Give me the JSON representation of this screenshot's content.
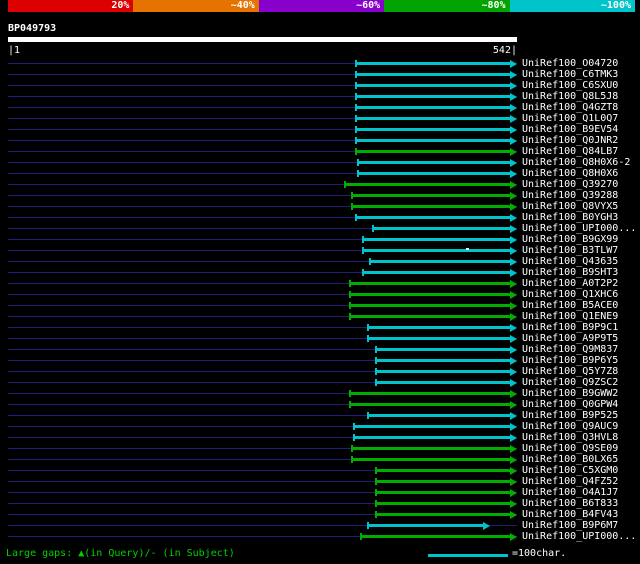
{
  "color_key": {
    "segments": [
      {
        "label": "20%",
        "color": "#dd0000"
      },
      {
        "label": "~40%",
        "color": "#e67300"
      },
      {
        "label": "~60%",
        "color": "#8800cc"
      },
      {
        "label": "~80%",
        "color": "#00a300"
      },
      {
        "label": "~100%",
        "color": "#00c4cc"
      }
    ]
  },
  "query": {
    "name": "BP049793",
    "start_tick": "|1",
    "end_tick": "542|"
  },
  "legend": {
    "gaps": "Large gaps: ▲(in Query)/- (in Subject)",
    "scale": "=100char."
  },
  "palette": {
    "~100%": "#00c4cc",
    "~80%": "#00ad00",
    "guide": "#1f1f7a",
    "query_bar": "#ffffff",
    "label": "#ffffff",
    "legend_green": "#00d000"
  },
  "chart_data": {
    "type": "bar",
    "orientation": "horizontal",
    "title": "BP049793",
    "xlabel": "",
    "xlim": [
      1,
      542
    ],
    "legend_note": "bar color encodes identity per color key; cyan ~100%, green ~80%; legend line length = 100 characters",
    "rows": [
      {
        "label": "UniRef100_O04720",
        "start": 370,
        "end": 542,
        "identity": "~100%"
      },
      {
        "label": "UniRef100_C6TMK3",
        "start": 370,
        "end": 542,
        "identity": "~100%"
      },
      {
        "label": "UniRef100_C6SXU0",
        "start": 370,
        "end": 542,
        "identity": "~100%"
      },
      {
        "label": "UniRef100_Q8L5J8",
        "start": 370,
        "end": 542,
        "identity": "~100%"
      },
      {
        "label": "UniRef100_Q4GZT8",
        "start": 370,
        "end": 542,
        "identity": "~100%"
      },
      {
        "label": "UniRef100_Q1L0Q7",
        "start": 370,
        "end": 542,
        "identity": "~100%"
      },
      {
        "label": "UniRef100_B9EV54",
        "start": 370,
        "end": 542,
        "identity": "~100%"
      },
      {
        "label": "UniRef100_Q0JNR2",
        "start": 370,
        "end": 542,
        "identity": "~100%"
      },
      {
        "label": "UniRef100_Q84LB7",
        "start": 370,
        "end": 542,
        "identity": "~80%"
      },
      {
        "label": "UniRef100_Q8H0X6-2",
        "start": 372,
        "end": 542,
        "identity": "~100%"
      },
      {
        "label": "UniRef100_Q8H0X6",
        "start": 372,
        "end": 542,
        "identity": "~100%"
      },
      {
        "label": "UniRef100_Q39270",
        "start": 358,
        "end": 542,
        "identity": "~80%"
      },
      {
        "label": "UniRef100_Q39288",
        "start": 366,
        "end": 542,
        "identity": "~80%"
      },
      {
        "label": "UniRef100_Q8VYX5",
        "start": 366,
        "end": 542,
        "identity": "~80%"
      },
      {
        "label": "UniRef100_B0YGH3",
        "start": 370,
        "end": 542,
        "identity": "~100%"
      },
      {
        "label": "UniRef100_UPI000...",
        "start": 388,
        "end": 542,
        "identity": "~100%"
      },
      {
        "label": "UniRef100_B9GX99",
        "start": 377,
        "end": 542,
        "identity": "~100%"
      },
      {
        "label": "UniRef100_B3TLW7",
        "start": 377,
        "end": 542,
        "identity": "~100%",
        "gaps": [
          488
        ]
      },
      {
        "label": "UniRef100_Q43635",
        "start": 385,
        "end": 542,
        "identity": "~100%"
      },
      {
        "label": "UniRef100_B9SHT3",
        "start": 377,
        "end": 542,
        "identity": "~100%"
      },
      {
        "label": "UniRef100_A0T2P2",
        "start": 363,
        "end": 542,
        "identity": "~80%"
      },
      {
        "label": "UniRef100_Q1XHC6",
        "start": 363,
        "end": 542,
        "identity": "~80%"
      },
      {
        "label": "UniRef100_B5ACE0",
        "start": 363,
        "end": 542,
        "identity": "~80%"
      },
      {
        "label": "UniRef100_Q1ENE9",
        "start": 363,
        "end": 542,
        "identity": "~80%"
      },
      {
        "label": "UniRef100_B9P9C1",
        "start": 383,
        "end": 542,
        "identity": "~100%"
      },
      {
        "label": "UniRef100_A9P9T5",
        "start": 383,
        "end": 542,
        "identity": "~100%"
      },
      {
        "label": "UniRef100_Q9M837",
        "start": 391,
        "end": 542,
        "identity": "~100%"
      },
      {
        "label": "UniRef100_B9P6Y5",
        "start": 391,
        "end": 542,
        "identity": "~100%"
      },
      {
        "label": "UniRef100_Q5Y7Z8",
        "start": 391,
        "end": 542,
        "identity": "~100%"
      },
      {
        "label": "UniRef100_Q9ZSC2",
        "start": 391,
        "end": 542,
        "identity": "~100%"
      },
      {
        "label": "UniRef100_B9GWW2",
        "start": 363,
        "end": 542,
        "identity": "~80%"
      },
      {
        "label": "UniRef100_Q0GPW4",
        "start": 363,
        "end": 542,
        "identity": "~80%"
      },
      {
        "label": "UniRef100_B9P525",
        "start": 383,
        "end": 542,
        "identity": "~100%"
      },
      {
        "label": "UniRef100_Q9AUC9",
        "start": 368,
        "end": 542,
        "identity": "~100%"
      },
      {
        "label": "UniRef100_Q3HVL8",
        "start": 368,
        "end": 542,
        "identity": "~100%"
      },
      {
        "label": "UniRef100_Q9SE09",
        "start": 366,
        "end": 542,
        "identity": "~80%"
      },
      {
        "label": "UniRef100_B0LX65",
        "start": 366,
        "end": 542,
        "identity": "~80%"
      },
      {
        "label": "UniRef100_C5XGM0",
        "start": 391,
        "end": 542,
        "identity": "~80%"
      },
      {
        "label": "UniRef100_Q4FZ52",
        "start": 391,
        "end": 542,
        "identity": "~80%"
      },
      {
        "label": "UniRef100_O4A1J7",
        "start": 391,
        "end": 542,
        "identity": "~80%"
      },
      {
        "label": "UniRef100_B6T833",
        "start": 391,
        "end": 542,
        "identity": "~80%"
      },
      {
        "label": "UniRef100_B4FV43",
        "start": 391,
        "end": 542,
        "identity": "~80%"
      },
      {
        "label": "UniRef100_B9P6M7",
        "start": 383,
        "end": 513,
        "identity": "~100%"
      },
      {
        "label": "UniRef100_UPI000...",
        "start": 375,
        "end": 542,
        "identity": "~80%"
      }
    ]
  }
}
